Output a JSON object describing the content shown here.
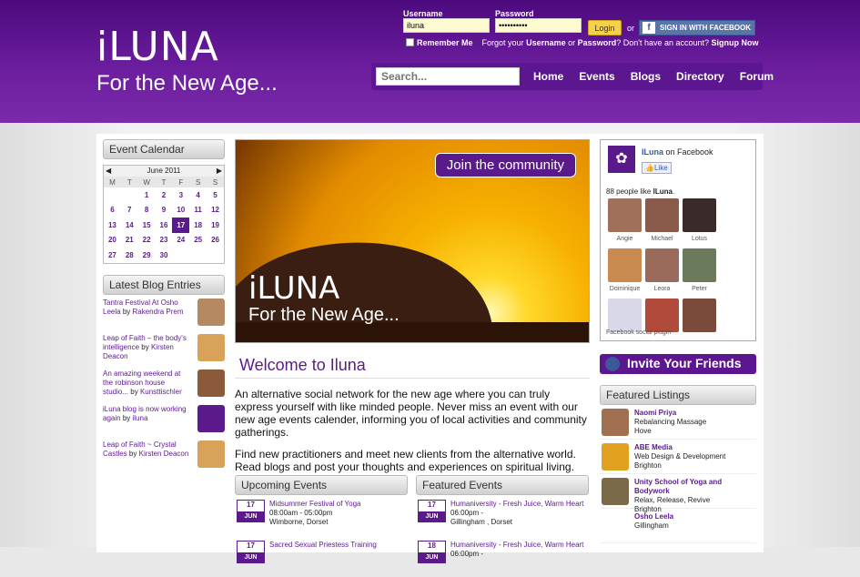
{
  "brand": {
    "logo": "iLUNA",
    "tagline": "For the New Age..."
  },
  "login": {
    "username_label": "Username",
    "username_value": "iluna",
    "password_label": "Password",
    "password_value": "••••••••••",
    "login_button": "Login",
    "or": "or",
    "facebook_signin": "SIGN IN WITH FACEBOOK",
    "remember_me": "Remember Me",
    "forgot_pre": "Forgot your",
    "forgot_username": "Username",
    "forgot_or": "or",
    "forgot_password": "Password",
    "no_account": "? Don't have an account?",
    "signup": "Signup Now"
  },
  "search": {
    "placeholder": "Search..."
  },
  "nav": [
    "Home",
    "Events",
    "Blogs",
    "Directory",
    "Forum"
  ],
  "calendar": {
    "heading": "Event Calendar",
    "month": "June 2011",
    "days": [
      "M",
      "T",
      "W",
      "T",
      "F",
      "S",
      "S"
    ],
    "weeks": [
      [
        "",
        "",
        "1",
        "2",
        "3",
        "4",
        "5"
      ],
      [
        "6",
        "7",
        "8",
        "9",
        "10",
        "11",
        "12"
      ],
      [
        "13",
        "14",
        "15",
        "16",
        "17",
        "18",
        "19"
      ],
      [
        "20",
        "21",
        "22",
        "23",
        "24",
        "25",
        "26"
      ],
      [
        "27",
        "28",
        "29",
        "30",
        "",
        "",
        ""
      ]
    ],
    "today": "17"
  },
  "blog": {
    "heading": "Latest Blog Entries",
    "items": [
      {
        "title": "Tantra Festival At Osho Leela",
        "by": "by",
        "author": "Rakendra Prem",
        "thumb_color": "#b58a62"
      },
      {
        "title": "Leap of Faith – the body's intelligence",
        "by": "by",
        "author": "Kirsten Deacon",
        "thumb_color": "#d9a25a"
      },
      {
        "title": "An amazing weekend at the robinson house studio...",
        "by": "by",
        "author": "Kunsttischler",
        "thumb_color": "#8a5a3a"
      },
      {
        "title": "iLuna blog is now working again",
        "by": "by",
        "author": "iluna",
        "thumb_color": "#5b1a8c"
      },
      {
        "title": "Leap of Faith ~ Crystal Castles",
        "by": "by",
        "author": "Kirsten Deacon",
        "thumb_color": "#d9a25a"
      }
    ]
  },
  "banner": {
    "join": "Join the community",
    "logo": "iLUNA",
    "tagline": "For the New Age..."
  },
  "welcome": {
    "title": "Welcome to Iluna",
    "p1": "An alternative social network for the new age where you can truly express yourself with like minded people. Never miss an event with our new age events calender, informing you of local activities and community gatherings.",
    "p2": "Find new practitioners and meet new clients from the alternative world. Read blogs and post your thoughts and experiences on spiritual living."
  },
  "upcoming": {
    "heading": "Upcoming Events",
    "items": [
      {
        "day": "17",
        "month": "JUN",
        "title": "Midsummer Festival of Yoga",
        "time": "08:00am - 05:00pm",
        "place": "Wimborne, Dorset"
      },
      {
        "day": "17",
        "month": "JUN",
        "title": "Sacred Sexual Priestess Training",
        "time": "",
        "place": ""
      }
    ]
  },
  "featured_events": {
    "heading": "Featured Events",
    "items": [
      {
        "day": "17",
        "month": "JUN",
        "title": "Humaniversity - Fresh Juice, Warm Heart",
        "time": "06:00pm -",
        "place": "Gillingham , Dorset"
      },
      {
        "day": "18",
        "month": "JUN",
        "title": "Humaniversity - Fresh Juice, Warm Heart",
        "time": "06:00pm -",
        "place": ""
      }
    ]
  },
  "facebook": {
    "page_name": "ILuna",
    "on_facebook": "on Facebook",
    "like": "Like",
    "count_pre": "88 people like",
    "count_name": "ILuna",
    "fans": [
      {
        "name": "Angie",
        "color": "#a0705a"
      },
      {
        "name": "Michael",
        "color": "#8a5a4a"
      },
      {
        "name": "Lotus",
        "color": "#3a2a2a"
      },
      {
        "name": "Dominique",
        "color": "#c98a50"
      },
      {
        "name": "Leora",
        "color": "#9a6a5a"
      },
      {
        "name": "Peter",
        "color": "#6a7a5a"
      },
      {
        "name": "",
        "color": "#d8d8e8"
      },
      {
        "name": "",
        "color": "#b04a3a"
      },
      {
        "name": "",
        "color": "#7a4a3a"
      }
    ],
    "plugin": "Facebook social plugin"
  },
  "invite": "Invite Your Friends",
  "featured_listings": {
    "heading": "Featured Listings",
    "items": [
      {
        "name": "Naomi Priya",
        "desc": "Rebalancing Massage",
        "place": "Hove",
        "color": "#a07050"
      },
      {
        "name": "ABE Media",
        "desc": "Web Design & Development",
        "place": "Brighton",
        "color": "#e0a020"
      },
      {
        "name": "Unity School of Yoga and Bodywork",
        "desc": "Relax, Release, Revive",
        "place": "Brighton",
        "color": "#7a6a4a"
      },
      {
        "name": "Osho Leela",
        "desc": "Gillingham",
        "place": "",
        "color": "#ffffff"
      }
    ]
  }
}
